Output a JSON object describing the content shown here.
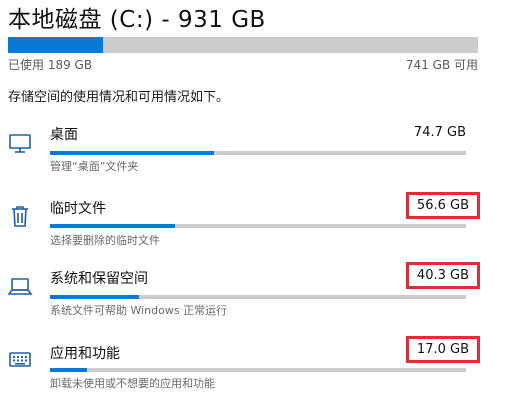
{
  "drive": {
    "title": "本地磁盘 (C:) - 931 GB",
    "used_fraction": 0.203,
    "used_label": "已使用 189 GB",
    "available_label": "741 GB 可用",
    "description": "存储空间的使用情况和可用情况如下。"
  },
  "categories": [
    {
      "name": "桌面",
      "size": "74.7 GB",
      "subtitle": "管理“桌面”文件夹",
      "fraction": 0.395,
      "icon": "monitor-icon",
      "highlighted": false
    },
    {
      "name": "临时文件",
      "size": "56.6 GB",
      "subtitle": "选择要删除的临时文件",
      "fraction": 0.3,
      "icon": "trash-icon",
      "highlighted": true
    },
    {
      "name": "系统和保留空间",
      "size": "40.3 GB",
      "subtitle": "系统文件可帮助 Windows 正常运行",
      "fraction": 0.213,
      "icon": "laptop-icon",
      "highlighted": true
    },
    {
      "name": "应用和功能",
      "size": "17.0 GB",
      "subtitle": "卸载未使用或不想要的应用和功能",
      "fraction": 0.09,
      "icon": "keyboard-icon",
      "highlighted": true
    }
  ],
  "colors": {
    "accent": "#0a78d7",
    "track": "#cccccc",
    "highlight_border": "#d9303a"
  }
}
